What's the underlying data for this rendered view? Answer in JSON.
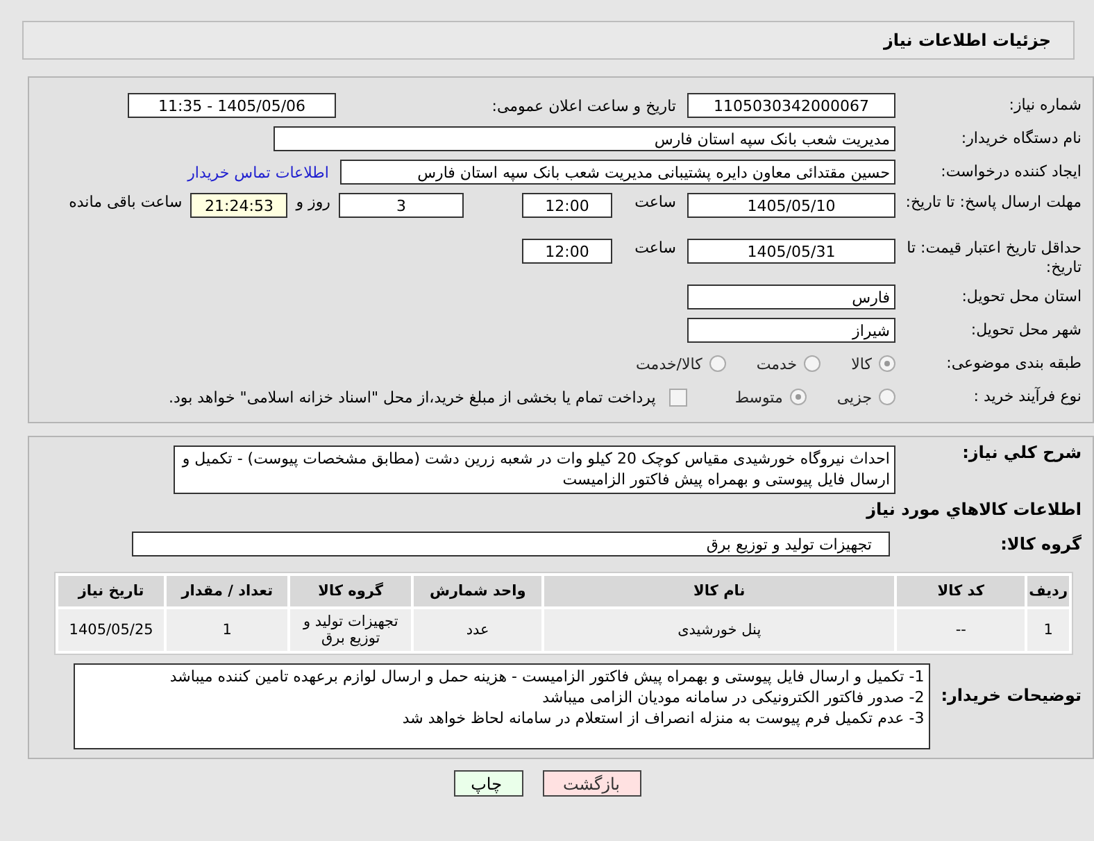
{
  "header": {
    "title": "جزئیات اطلاعات نیاز"
  },
  "need_number": {
    "label": "شماره نیاز:",
    "value": "1105030342000067"
  },
  "announce": {
    "label": "تاریخ و ساعت اعلان عمومی:",
    "value": "1405/05/06 - 11:35"
  },
  "buyer_org": {
    "label": "نام دستگاه خریدار:",
    "value": "مدیریت شعب بانک سپه استان فارس"
  },
  "requester": {
    "label": "ایجاد کننده درخواست:",
    "value": "حسین مقتدائی معاون  دایره پشتیبانی مدیریت شعب بانک سپه استان فارس",
    "link": "اطلاعات تماس خریدار"
  },
  "deadline": {
    "label": "مهلت ارسال پاسخ: تا تاریخ:",
    "date": "1405/05/10",
    "time_label": "ساعت",
    "time": "12:00",
    "days": "3",
    "days_label": "روز و",
    "remaining": "21:24:53",
    "remaining_label": "ساعت باقی مانده"
  },
  "validity": {
    "label": "حداقل تاریخ اعتبار قیمت: تا تاریخ:",
    "date": "1405/05/31",
    "time_label": "ساعت",
    "time": "12:00"
  },
  "province": {
    "label": "استان محل تحویل:",
    "value": "فارس"
  },
  "city": {
    "label": "شهر محل تحویل:",
    "value": "شیراز"
  },
  "category": {
    "label": "طبقه بندی موضوعی:",
    "options": [
      {
        "label": "کالا",
        "selected": true
      },
      {
        "label": "خدمت",
        "selected": false
      },
      {
        "label": "کالا/خدمت",
        "selected": false
      }
    ]
  },
  "purchase_type": {
    "label": "نوع فرآیند خرید :",
    "options": [
      {
        "label": "جزیی",
        "selected": false
      },
      {
        "label": "متوسط",
        "selected": true
      }
    ],
    "payment": {
      "checked": false,
      "text": "پرداخت تمام یا بخشی از مبلغ خرید،از محل \"اسناد خزانه اسلامی\" خواهد بود."
    }
  },
  "description": {
    "label": "شرح کلي نياز:",
    "text": "احداث نیروگاه خورشیدی مقیاس کوچک 20 کیلو وات در شعبه زرین دشت (مطابق مشخصات پیوست) - تکمیل و ارسال فایل پیوستی و بهمراه پیش فاکتور الزامیست"
  },
  "goods": {
    "title": "اطلاعات کالاهاي مورد نياز",
    "group_label": "گروه کالا:",
    "group_value": "تجهیزات تولید و توزیع برق",
    "table": {
      "columns": [
        "ردیف",
        "کد کالا",
        "نام کالا",
        "واحد شمارش",
        "گروه کالا",
        "تعداد / مقدار",
        "تاریخ نیاز"
      ],
      "rows": [
        [
          "1",
          "--",
          "پنل خورشیدی",
          "عدد",
          "تجهیزات تولید و توزیع برق",
          "1",
          "1405/05/25"
        ]
      ]
    }
  },
  "buyer_notes": {
    "label": "توضیحات خریدار:",
    "lines": [
      "1- تکمیل و ارسال فایل پیوستی و بهمراه پیش فاکتور الزامیست - هزینه حمل و ارسال لوازم برعهده تامین کننده میباشد",
      "2- صدور فاکتور الکترونیکی در سامانه مودیان الزامی میباشد",
      "3- عدم تکمیل فرم پیوست به منزله انصراف از استعلام در سامانه لحاظ خواهد شد"
    ]
  },
  "buttons": [
    {
      "label": "بازگشت",
      "kind": "back"
    },
    {
      "label": "چاپ",
      "kind": "print"
    }
  ]
}
